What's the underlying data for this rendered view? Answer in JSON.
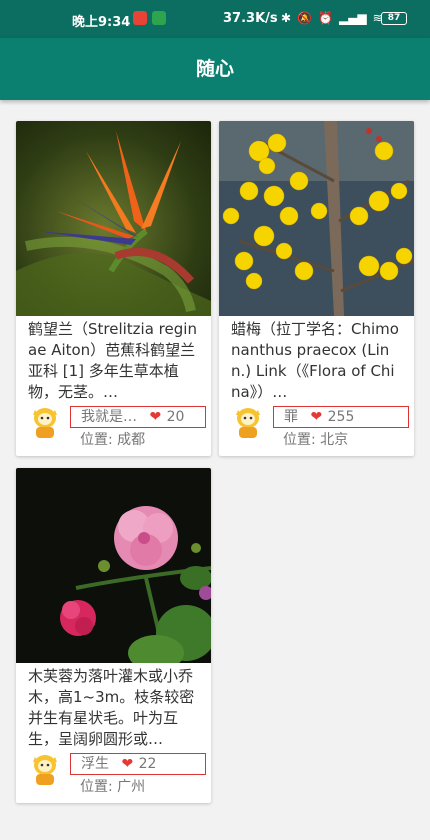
{
  "status_bar": {
    "time": "晚上9:34",
    "net_speed": "37.3K/s",
    "battery": "87",
    "icons": [
      "bluetooth-icon",
      "mute-icon",
      "alarm-icon",
      "signal-icon",
      "wifi-icon"
    ]
  },
  "app_bar": {
    "title": "随心"
  },
  "cards": [
    {
      "description": "鹤望兰（Strelitzia reginae Aiton）芭蕉科鹤望兰亚科 [1] 多年生草本植物，无茎。…",
      "author": "我就是…",
      "likes": "20",
      "location": "位置: 成都",
      "image": "bird-of-paradise-flower"
    },
    {
      "description": "蜡梅（拉丁学名：Chimonanthus praecox (Linn.) Link（《Flora of China》）…",
      "author": "罪",
      "likes": "255",
      "location": "位置: 北京",
      "image": "wintersweet-flowers"
    },
    {
      "description": "木芙蓉为落叶灌木或小乔木，高1~3m。枝条较密并生有星状毛。叶为互生，呈阔卵圆形或…",
      "author": "浮生",
      "likes": "22",
      "location": "位置: 广州",
      "image": "cotton-rose-hibiscus"
    }
  ],
  "colors": {
    "status_bar": "#0b6e61",
    "app_bar": "#0b7f70",
    "like_heart": "#e53935",
    "highlight_border": "#dd3333"
  }
}
